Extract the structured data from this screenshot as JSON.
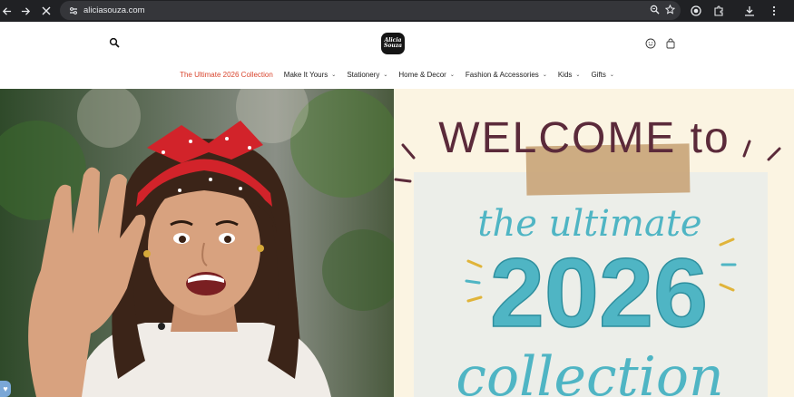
{
  "browser": {
    "url": "aliciasouza.com",
    "icons": {
      "back": "arrow-left-icon",
      "forward": "arrow-right-icon",
      "stop": "close-icon",
      "site_info": "tune-icon",
      "zoom": "zoom-icon",
      "bookmark": "star-icon",
      "extension": "extension-icon",
      "puzzle": "puzzle-icon",
      "download": "download-icon",
      "menu": "more-icon"
    }
  },
  "header": {
    "logo_line1": "Alicia",
    "logo_line2": "Souza"
  },
  "nav": {
    "items": [
      {
        "label": "The Ultimate 2026 Collection"
      },
      {
        "label": "Make It Yours"
      },
      {
        "label": "Stationery"
      },
      {
        "label": "Home & Decor"
      },
      {
        "label": "Fashion & Accessories"
      },
      {
        "label": "Kids"
      },
      {
        "label": "Gifts"
      }
    ]
  },
  "hero": {
    "welcome_text": "WELCOME to",
    "the_ultimate": "the ultimate",
    "year": "2026",
    "collection": "collection"
  },
  "colors": {
    "accent_red": "#d9462f",
    "chrome_bg": "#202124",
    "teal": "#4fb5c4",
    "maroon": "#5b2a3a"
  }
}
